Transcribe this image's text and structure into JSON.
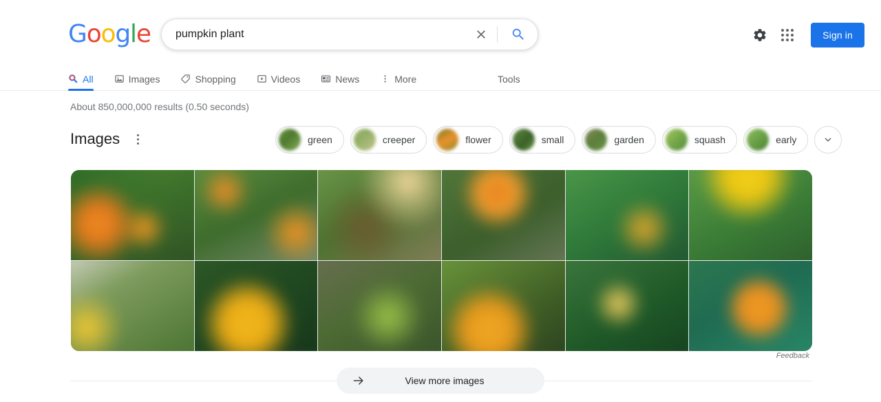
{
  "brand": {
    "name": "Google",
    "letters": [
      {
        "ch": "G",
        "color": "#4285f4"
      },
      {
        "ch": "o",
        "color": "#ea4335"
      },
      {
        "ch": "o",
        "color": "#fbbc05"
      },
      {
        "ch": "g",
        "color": "#4285f4"
      },
      {
        "ch": "l",
        "color": "#34a853"
      },
      {
        "ch": "e",
        "color": "#ea4335"
      }
    ]
  },
  "search": {
    "value": "pumpkin plant",
    "placeholder": "Search",
    "clear_icon": "close-icon",
    "search_icon": "search-icon",
    "accent": "#4285f4"
  },
  "header": {
    "settings_icon": "gear-icon",
    "apps_icon": "apps-grid-icon",
    "sign_in_label": "Sign in",
    "sign_in_color": "#1a73e8"
  },
  "nav": {
    "tabs": [
      {
        "label": "All",
        "icon": "search-icon",
        "active": true
      },
      {
        "label": "Images",
        "icon": "image-icon",
        "active": false
      },
      {
        "label": "Shopping",
        "icon": "tag-icon",
        "active": false
      },
      {
        "label": "Videos",
        "icon": "video-icon",
        "active": false
      },
      {
        "label": "News",
        "icon": "newspaper-icon",
        "active": false
      },
      {
        "label": "More",
        "icon": "kebab-icon",
        "active": false
      }
    ],
    "tools_label": "Tools",
    "active_color": "#1a73e8"
  },
  "results": {
    "stats": "About 850,000,000 results (0.50 seconds)"
  },
  "images_block": {
    "title": "Images",
    "menu_icon": "kebab-icon",
    "expand_icon": "chevron-down-icon",
    "feedback_label": "Feedback",
    "chips": [
      {
        "label": "green",
        "thumb": "linear-gradient(135deg,#7faa4e 0%,#4e7a2e 45%,#9ec46b 100%)"
      },
      {
        "label": "creeper",
        "thumb": "linear-gradient(140deg,#cdbb8e 0%,#8fae63 40%,#d8cf9e 100%)"
      },
      {
        "label": "flower",
        "thumb": "linear-gradient(150deg,#3f6b2b 0%,#e8922a 50%,#5d8a36 100%)"
      },
      {
        "label": "small",
        "thumb": "linear-gradient(130deg,#6f9e52 0%,#3c6128 55%,#8bbd66 100%)"
      },
      {
        "label": "garden",
        "thumb": "linear-gradient(140deg,#9c8f72 0%,#5c7f3c 50%,#79a152 100%)"
      },
      {
        "label": "squash",
        "thumb": "linear-gradient(135deg,#c7d96a 0%,#74a84a 50%,#4b7c32 100%)"
      },
      {
        "label": "early",
        "thumb": "linear-gradient(140deg,#a6cc6e 0%,#649c42 55%,#3f7030 100%)"
      }
    ],
    "grid": {
      "rows": 2,
      "columns": 6,
      "cells": [
        {
          "alt": "pumpkin-plant-thumbnail-1",
          "bg": "radial-gradient(circle at 26% 58%, #f08a23 0%, #e07a1c 14%, rgba(224,122,28,0) 34%), radial-gradient(circle at 58% 62%, #f2981f 0%, rgba(242,152,31,0) 22%), radial-gradient(circle at 12% 18%, #2f6b27 0%, rgba(47,107,39,0) 55%), linear-gradient(160deg, #4f8a33 0%, #3c6f2a 45%, #2e4f24 100%)"
        },
        {
          "alt": "pumpkin-plant-thumbnail-2",
          "bg": "radial-gradient(circle at 28% 28%, #ef8f26 0%, rgba(239,143,38,0) 20%), radial-gradient(circle at 78% 66%, #f0941f 0%, rgba(240,148,31,0) 24%), linear-gradient(155deg, #5f9140 0%, #3d6c2c 50%, #7f8d74 100%)"
        },
        {
          "alt": "pumpkin-plant-thumbnail-3",
          "bg": "radial-gradient(circle at 70% 20%, #efd79a 0%, rgba(239,215,154,0) 36%), radial-gradient(circle at 40% 62%, #6b5a2d 0%, rgba(107,90,45,0) 40%), linear-gradient(150deg, #6f9b4b 0%, #4c7230 48%, #8a7f5e 100%)"
        },
        {
          "alt": "pumpkin-plant-thumbnail-4",
          "bg": "radial-gradient(circle at 46% 30%, #e8801f 0%, #ef9a2b 16%, rgba(239,154,43,0) 34%), linear-gradient(150deg, #547a3d 0%, #3b5e2b 55%, #6e7a5d 100%)"
        },
        {
          "alt": "pumpkin-plant-thumbnail-5",
          "bg": "radial-gradient(circle at 62% 62%, #e0a52a 0%, rgba(224,165,42,0) 26%), linear-gradient(150deg, #4f9b4a 0%, #2f7a3a 50%, #1f5230 100%)"
        },
        {
          "alt": "pumpkin-plant-thumbnail-6",
          "bg": "radial-gradient(circle at 48% 14%, #f3d01a 0%, #e8c514 18%, rgba(232,197,20,0) 40%), linear-gradient(155deg, #5ea048 0%, #3a7c36 55%, #2c5c2c 100%)"
        },
        {
          "alt": "pumpkin-plant-thumbnail-7",
          "bg": "radial-gradient(circle at 18% 70%, #f0c832 0%, rgba(240,200,50,0) 26%), linear-gradient(150deg, #d9d9cf 0%, #7d9b5c 35%, #46702f 100%)"
        },
        {
          "alt": "pumpkin-plant-thumbnail-8",
          "bg": "radial-gradient(circle at 44% 66%, #f2b81c 0%, #e8aa16 22%, rgba(232,170,22,0) 44%), linear-gradient(150deg, #2f5a26 0%, #1e4620 55%, #16351a 100%)"
        },
        {
          "alt": "pumpkin-plant-thumbnail-9",
          "bg": "radial-gradient(circle at 56% 60%, #9cc248 0%, rgba(156,194,72,0) 34%), linear-gradient(150deg, #6b6f52 0%, #4c6a33 50%, #37512a 100%)"
        },
        {
          "alt": "pumpkin-plant-thumbnail-10",
          "bg": "radial-gradient(circle at 40% 72%, #f0a825 0%, #e69a1c 20%, rgba(230,154,28,0) 40%), linear-gradient(150deg, #6f9a3c 0%, #3f5e26 60%, #2a3f1e 100%)"
        },
        {
          "alt": "pumpkin-plant-thumbnail-11",
          "bg": "radial-gradient(circle at 44% 48%, #f1cd5c 0%, rgba(241,205,92,0) 26%), linear-gradient(150deg, #3f7a40 0%, #1f5a28 55%, #15401f 100%)"
        },
        {
          "alt": "pumpkin-plant-thumbnail-12",
          "bg": "radial-gradient(circle at 56% 52%, #ee9b24 0%, #e89020 18%, rgba(232,144,32,0) 36%), linear-gradient(150deg, #2f7a4e 0%, #1f6b52 45%, #2a8a6a 100%)"
        }
      ]
    }
  },
  "footer": {
    "view_more_label": "View more images",
    "view_more_icon": "arrow-right-icon"
  }
}
